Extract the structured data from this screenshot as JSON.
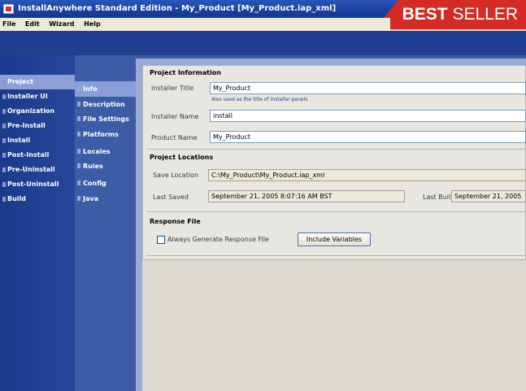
{
  "window": {
    "title": "InstallAnywhere Standard Edition - My_Product [My_Product.iap_xml]"
  },
  "banner": {
    "bold": "BEST",
    "rest": " SELLER"
  },
  "menu": [
    "File",
    "Edit",
    "Wizard",
    "Help"
  ],
  "left_nav": {
    "items": [
      {
        "label": "Project",
        "active": true
      },
      {
        "label": "Installer UI",
        "active": false
      },
      {
        "label": "Organization",
        "active": false
      },
      {
        "label": "Pre-Install",
        "active": false
      },
      {
        "label": "Install",
        "active": false
      },
      {
        "label": "Post-Install",
        "active": false
      },
      {
        "label": "Pre-Uninstall",
        "active": false
      },
      {
        "label": "Post-Uninstall",
        "active": false
      },
      {
        "label": "Build",
        "active": false
      }
    ]
  },
  "sub_nav": {
    "items": [
      {
        "label": "Info",
        "active": true
      },
      {
        "label": "Description",
        "active": false
      },
      {
        "label": "File Settings",
        "active": false
      },
      {
        "label": "Platforms",
        "active": false
      },
      {
        "label": "Locales",
        "active": false
      },
      {
        "label": "Rules",
        "active": false
      },
      {
        "label": "Config",
        "active": false
      },
      {
        "label": "Java",
        "active": false
      }
    ]
  },
  "project_information": {
    "heading": "Project Information",
    "installer_title_label": "Installer Title",
    "installer_title_value": "My_Product",
    "installer_title_hint": "Also used as the title of installer panels",
    "installer_name_label": "Installer Name",
    "installer_name_value": "install",
    "product_name_label": "Product Name",
    "product_name_value": "My_Product"
  },
  "project_locations": {
    "heading": "Project Locations",
    "save_location_label": "Save Location",
    "save_location_value": "C:\\My_Product\\My_Product.iap_xml",
    "last_saved_label": "Last Saved",
    "last_saved_value": "September 21, 2005 8:07:16 AM BST",
    "last_built_label": "Last Built",
    "last_built_value": "September 21, 2005"
  },
  "response_file": {
    "heading": "Response File",
    "checkbox_label": "Always Generate Response File",
    "checkbox_checked": false,
    "button_label": "Include Variables"
  },
  "colors": {
    "title_bar": "#1740a2",
    "nav_background": "#1c3a8c",
    "active_nav": "#8da0d6",
    "banner_red": "#d42b24"
  }
}
